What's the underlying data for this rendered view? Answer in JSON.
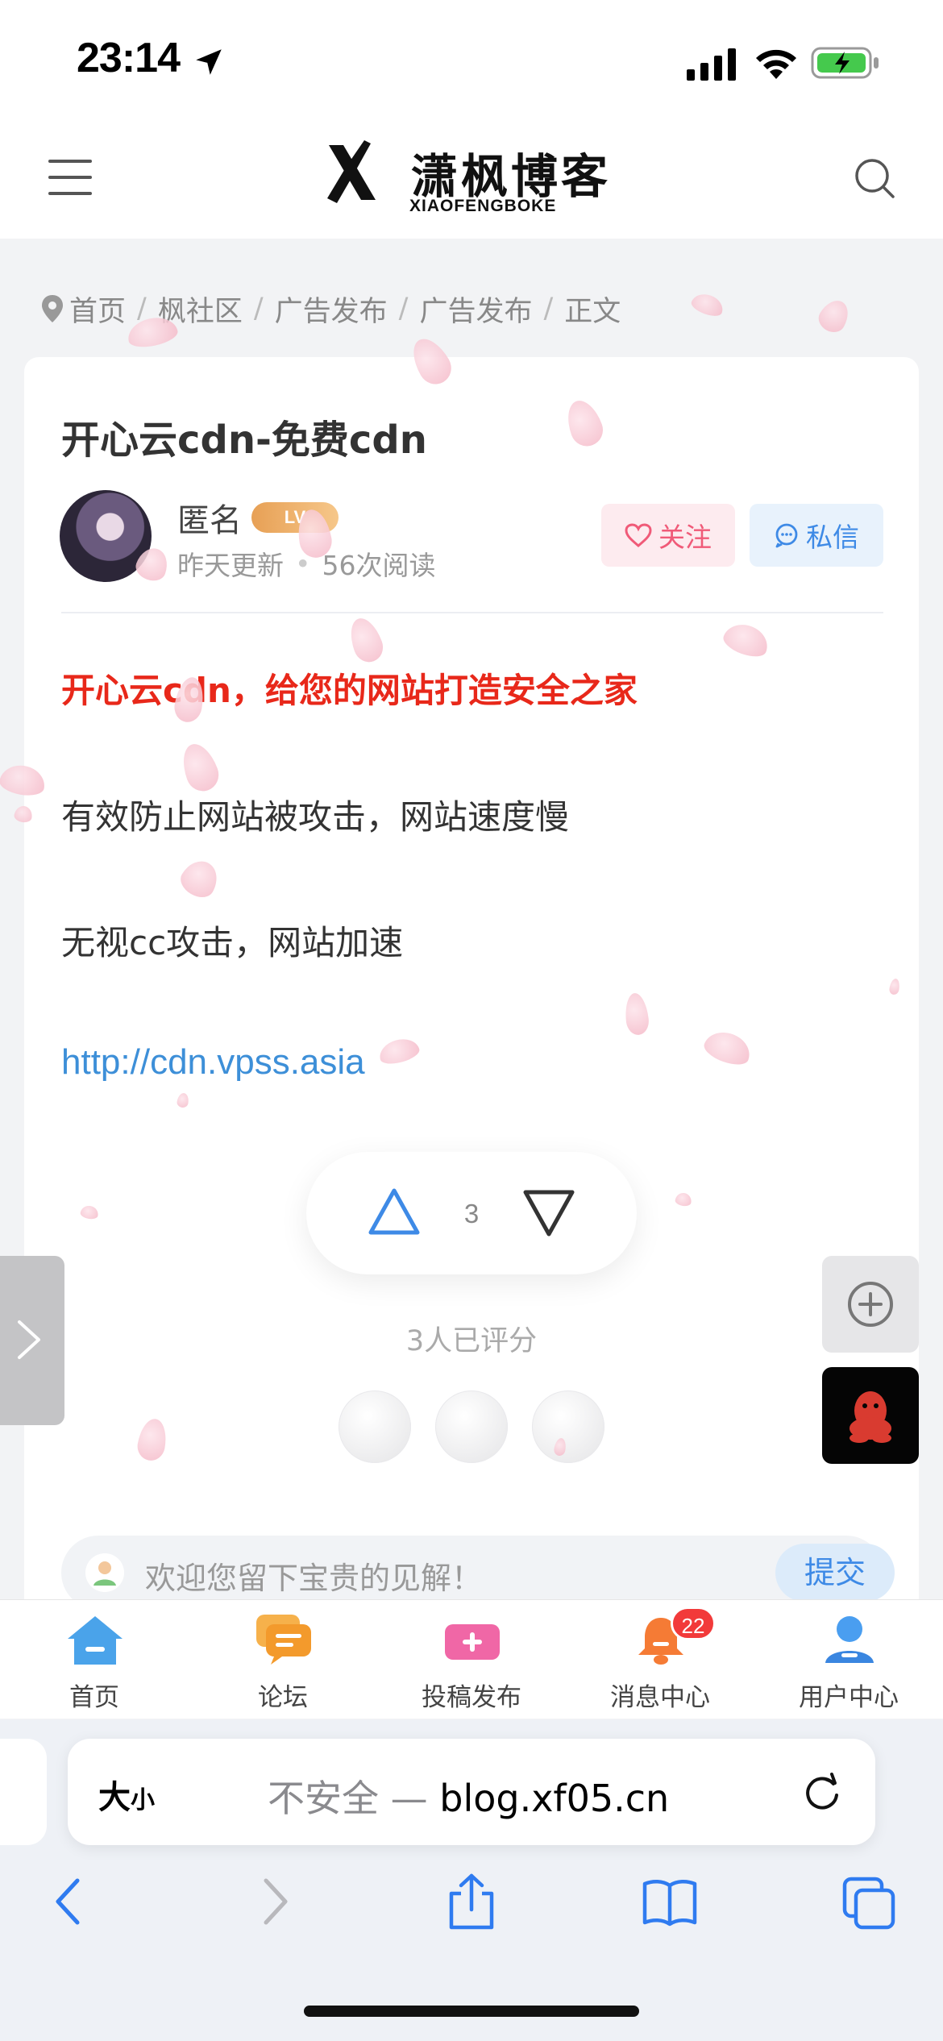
{
  "status_bar": {
    "time": "23:14"
  },
  "header": {
    "logo_title": "潇枫博客",
    "logo_subtitle": "XIAOFENGBOKE",
    "menu_icon": "hamburger-icon",
    "search_icon": "search-icon"
  },
  "breadcrumb": {
    "items": [
      "首页",
      "枫社区",
      "广告发布",
      "广告发布",
      "正文"
    ],
    "separator": "/"
  },
  "post": {
    "title": "开心云cdn-免费cdn",
    "author": "匿名",
    "level": "LV",
    "updated": "昨天更新",
    "views": "56次阅读",
    "follow_label": "关注",
    "message_label": "私信",
    "content": {
      "headline": "开心云cdn，给您的网站打造安全之家",
      "line1": "有效防止网站被攻击，网站速度慢",
      "line2": "无视cc攻击，网站加速",
      "link": "http://cdn.vpss.asia"
    },
    "vote_count": "3",
    "rated_text": "3人已评分",
    "comment_placeholder": "欢迎您留下宝贵的见解！",
    "submit_label": "提交"
  },
  "tabbar": {
    "items": [
      {
        "label": "首页",
        "icon": "home-icon"
      },
      {
        "label": "论坛",
        "icon": "forum-icon"
      },
      {
        "label": "投稿发布",
        "icon": "publish-icon"
      },
      {
        "label": "消息中心",
        "icon": "bell-icon",
        "badge": "22"
      },
      {
        "label": "用户中心",
        "icon": "user-icon"
      }
    ]
  },
  "browser": {
    "text_size_label": "大",
    "text_size_small": "小",
    "insecure_label": "不安全 —",
    "domain": "blog.xf05.cn"
  },
  "colors": {
    "accent_blue": "#3e8ae6",
    "headline_red": "#e8281a",
    "follow_pink": "#f05a78",
    "badge_red": "#f23a3a"
  }
}
